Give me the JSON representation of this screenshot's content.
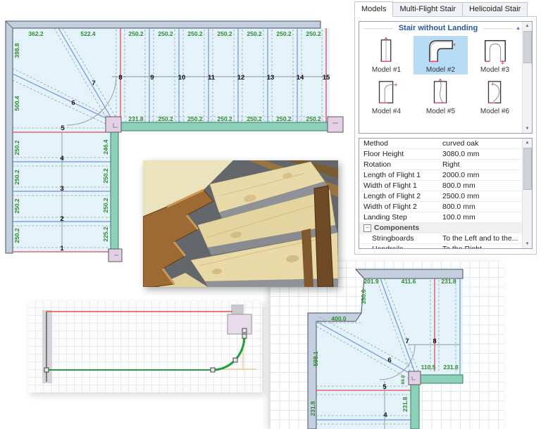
{
  "right_panel": {
    "tabs": [
      {
        "label": "Models",
        "active": true
      },
      {
        "label": "Multi-Flight Stair",
        "active": false
      },
      {
        "label": "Helicoidal Stair",
        "active": false
      }
    ],
    "models_box": {
      "header": "Stair without Landing",
      "models": [
        {
          "label": "Model #1"
        },
        {
          "label": "Model #2"
        },
        {
          "label": "Model #3"
        },
        {
          "label": "Model #4"
        },
        {
          "label": "Model #5"
        },
        {
          "label": "Model #6"
        }
      ],
      "selected_model": "Model #2"
    },
    "properties": {
      "rows": [
        {
          "label": "Method",
          "value": "curved oak"
        },
        {
          "label": "Floor Height",
          "value": "3080.0 mm"
        },
        {
          "label": "Rotation",
          "value": "Right"
        },
        {
          "label": "Length of Flight 1",
          "value": "2000.0 mm"
        },
        {
          "label": "Width of Flight 1",
          "value": "800.0 mm"
        },
        {
          "label": "Length of Flight 2",
          "value": "2500.0 mm"
        },
        {
          "label": "Width of Flight 2",
          "value": "800.0 mm"
        },
        {
          "label": "Landing Step",
          "value": "100.0 mm"
        },
        {
          "label": "Components",
          "value": ""
        },
        {
          "label": "Stringboards",
          "value": "To the Left and to the..."
        },
        {
          "label": "Handrails",
          "value": "To the Right"
        }
      ]
    }
  },
  "plan_top_left": {
    "top_dims": [
      "362.2",
      "522.4",
      "250.2",
      "250.2",
      "250.2",
      "250.2",
      "250.2",
      "250.2",
      "250.2"
    ],
    "bottom_dims": [
      "231.8",
      "250.2",
      "250.2",
      "250.2",
      "250.2",
      "250.2",
      "250.2"
    ],
    "left_dims": [
      "398.8",
      "500.4",
      "250.2",
      "250.2",
      "250.2",
      "250.2"
    ],
    "right_dims": [
      "246.4",
      "250.2",
      "250.2",
      "225.2"
    ],
    "steps": [
      "1",
      "2",
      "3",
      "4",
      "5",
      "6",
      "7",
      "8",
      "9",
      "10",
      "11",
      "12",
      "13",
      "14",
      "15"
    ]
  },
  "plan_bottom_right": {
    "top_dims": [
      "201.9",
      "411.6",
      "231.8"
    ],
    "dims": {
      "flight_width": "350.0",
      "diagonal": "400.0",
      "left_mid": "598.1",
      "left_bottom": "231.8",
      "center_bottom": "231.8",
      "post_side": "69.8",
      "post_right_1": "110.5",
      "post_right_2": "231.8"
    },
    "steps": [
      "4",
      "5",
      "6",
      "7",
      "8"
    ]
  },
  "icons": {
    "collapse_chevron": "▲",
    "scroll_up": "▲",
    "scroll_down": "▼",
    "expand_minus": "−"
  },
  "colors": {
    "dim_text": "#2e8b2e",
    "step_edge_blue": "#6b96d6",
    "boundary_red": "#e04858",
    "stringboard_teal": "#8ecfb9",
    "post_pink": "#e3d0e6",
    "wall_gray_blue": "#c3cede",
    "stair_fill": "#e4f2f9",
    "selected_model_bg": "#b9dcf6",
    "header_blue": "#2456a4"
  }
}
